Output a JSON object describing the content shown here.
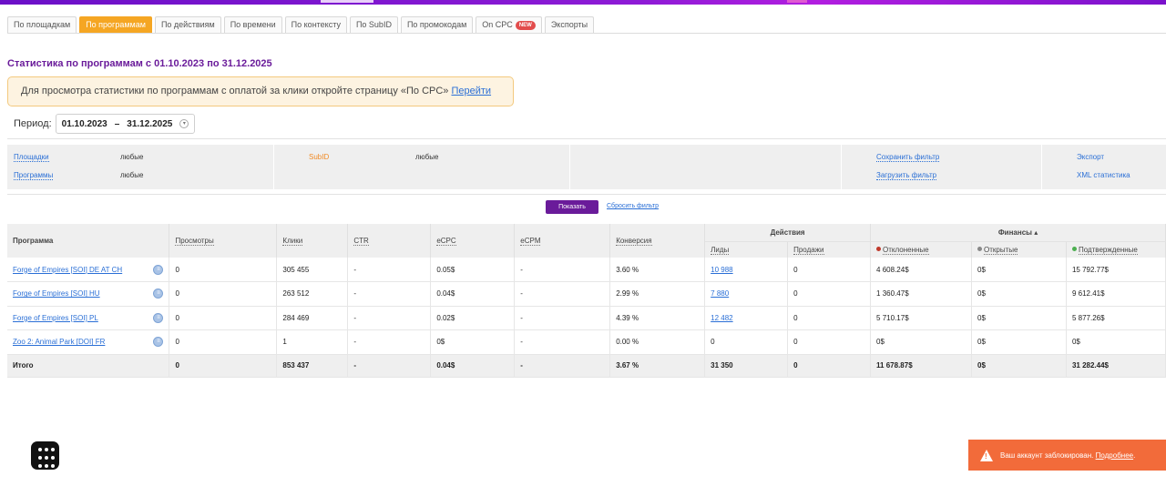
{
  "tabs": [
    {
      "label": "По площадкам",
      "active": false
    },
    {
      "label": "По программам",
      "active": true
    },
    {
      "label": "По действиям",
      "active": false
    },
    {
      "label": "По времени",
      "active": false
    },
    {
      "label": "По контексту",
      "active": false
    },
    {
      "label": "По SubID",
      "active": false
    },
    {
      "label": "По промокодам",
      "active": false
    },
    {
      "label": "On CPC",
      "active": false,
      "badge": "NEW"
    },
    {
      "label": "Экспорты",
      "active": false
    }
  ],
  "page_title": "Статистика по программам с 01.10.2023 по 31.12.2025",
  "notice": {
    "text": "Для просмотра статистики по программам с оплатой за клики откройте страницу «По CPC» ",
    "link": "Перейти"
  },
  "period": {
    "label": "Период:",
    "from": "01.10.2023",
    "dash": "–",
    "to": "31.12.2025"
  },
  "filters": {
    "sites_label": "Площадки",
    "sites_value": "любые",
    "programs_label": "Программы",
    "programs_value": "любые",
    "subid_label": "SubID",
    "subid_value": "любые",
    "save_filter": "Сохранить фильтр",
    "load_filter": "Загрузить фильтр",
    "export": "Экспорт",
    "xml_stats": "XML статистика"
  },
  "actions": {
    "show_button": "Показать",
    "reset_filter": "Сбросить фильтр"
  },
  "table": {
    "headers": {
      "program": "Программа",
      "views": "Просмотры",
      "clicks": "Клики",
      "ctr": "CTR",
      "ecpc": "eCPC",
      "ecpm": "eCPM",
      "conversion": "Конверсия",
      "actions_group": "Действия",
      "leads": "Лиды",
      "sales": "Продажи",
      "finance_group": "Финансы ▴",
      "rejected": "Отклоненные",
      "open": "Открытые",
      "confirmed": "Подтвержденные"
    },
    "rows": [
      {
        "program": "Forge of Empires [SOI] DE AT CH",
        "views": "0",
        "clicks": "305 455",
        "ctr": "-",
        "ecpc": "0.05$",
        "ecpm": "-",
        "conversion": "3.60 %",
        "leads": "10 988",
        "sales": "0",
        "rejected": "4 608.24$",
        "open": "0$",
        "confirmed": "15 792.77$"
      },
      {
        "program": "Forge of Empires [SOI] HU",
        "views": "0",
        "clicks": "263 512",
        "ctr": "-",
        "ecpc": "0.04$",
        "ecpm": "-",
        "conversion": "2.99 %",
        "leads": "7 880",
        "sales": "0",
        "rejected": "1 360.47$",
        "open": "0$",
        "confirmed": "9 612.41$"
      },
      {
        "program": "Forge of Empires [SOI] PL",
        "views": "0",
        "clicks": "284 469",
        "ctr": "-",
        "ecpc": "0.02$",
        "ecpm": "-",
        "conversion": "4.39 %",
        "leads": "12 482",
        "sales": "0",
        "rejected": "5 710.17$",
        "open": "0$",
        "confirmed": "5 877.26$"
      },
      {
        "program": "Zoo 2: Animal Park [DOI] FR",
        "views": "0",
        "clicks": "1",
        "ctr": "-",
        "ecpc": "0$",
        "ecpm": "-",
        "conversion": "0.00 %",
        "leads": "0",
        "sales": "0",
        "rejected": "0$",
        "open": "0$",
        "confirmed": "0$"
      }
    ],
    "total": {
      "label": "Итого",
      "views": "0",
      "clicks": "853 437",
      "ctr": "-",
      "ecpc": "0.04$",
      "ecpm": "-",
      "conversion": "3.67 %",
      "leads": "31 350",
      "sales": "0",
      "rejected": "11 678.87$",
      "open": "0$",
      "confirmed": "31 282.44$"
    }
  },
  "toast": {
    "text": "Ваш аккаунт заблокирован. ",
    "link": "Подробнее",
    "suffix": "."
  },
  "colors": {
    "brand": "#6a1b9a",
    "active_tab": "#f5a623",
    "link": "#2a6fd6",
    "toast": "#f26b3a",
    "rejected_dot": "#c0392b",
    "open_dot": "#888888",
    "confirmed_dot": "#4caf50"
  },
  "icons": {
    "apps": "apps-grid-icon",
    "program_info": "info-circle-icon",
    "warning": "warning-triangle-icon"
  }
}
